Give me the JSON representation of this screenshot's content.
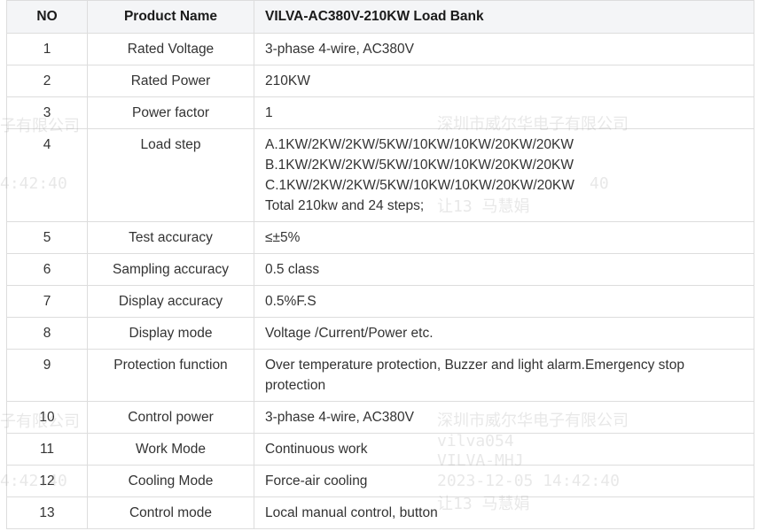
{
  "table": {
    "headers": [
      "NO",
      "Product Name",
      "VILVA-AC380V-210KW Load Bank"
    ],
    "rows": [
      {
        "no": "1",
        "name": "Rated Voltage",
        "value": [
          "3-phase 4-wire, AC380V"
        ]
      },
      {
        "no": "2",
        "name": "Rated Power",
        "value": [
          "210KW"
        ]
      },
      {
        "no": "3",
        "name": "Power factor",
        "value": [
          "1"
        ]
      },
      {
        "no": "4",
        "name": "Load step",
        "value": [
          "A.1KW/2KW/2KW/5KW/10KW/10KW/20KW/20KW",
          "B.1KW/2KW/2KW/5KW/10KW/10KW/20KW/20KW",
          "C.1KW/2KW/2KW/5KW/10KW/10KW/20KW/20KW",
          "Total 210kw and 24 steps;"
        ]
      },
      {
        "no": "5",
        "name": "Test accuracy",
        "value": [
          "≤±5%"
        ]
      },
      {
        "no": "6",
        "name": "Sampling accuracy",
        "value": [
          "0.5 class"
        ]
      },
      {
        "no": "7",
        "name": "Display accuracy",
        "value": [
          "0.5%F.S"
        ]
      },
      {
        "no": "8",
        "name": "Display mode",
        "value": [
          "Voltage /Current/Power etc."
        ]
      },
      {
        "no": "9",
        "name": "Protection function",
        "value": [
          "Over temperature protection, Buzzer and light alarm.Emergency stop",
          "protection"
        ]
      },
      {
        "no": "10",
        "name": "Control power",
        "value": [
          "3-phase 4-wire, AC380V"
        ]
      },
      {
        "no": "11",
        "name": "Work Mode",
        "value": [
          "Continuous work"
        ]
      },
      {
        "no": "12",
        "name": "Cooling Mode",
        "value": [
          "Force-air cooling"
        ]
      },
      {
        "no": "13",
        "name": "Control mode",
        "value": [
          "Local manual control, button"
        ]
      }
    ]
  },
  "watermark": {
    "company": "深圳市威尔华电子有限公司",
    "company_partial": "子有限公司",
    "user": "vilva054",
    "dept": "VILVA-MHJ",
    "timestamp": "2023-12-05 14:42:40",
    "time_partial": "4:42:40",
    "time_partial2": "40",
    "name_line": "让13  马慧娟"
  }
}
